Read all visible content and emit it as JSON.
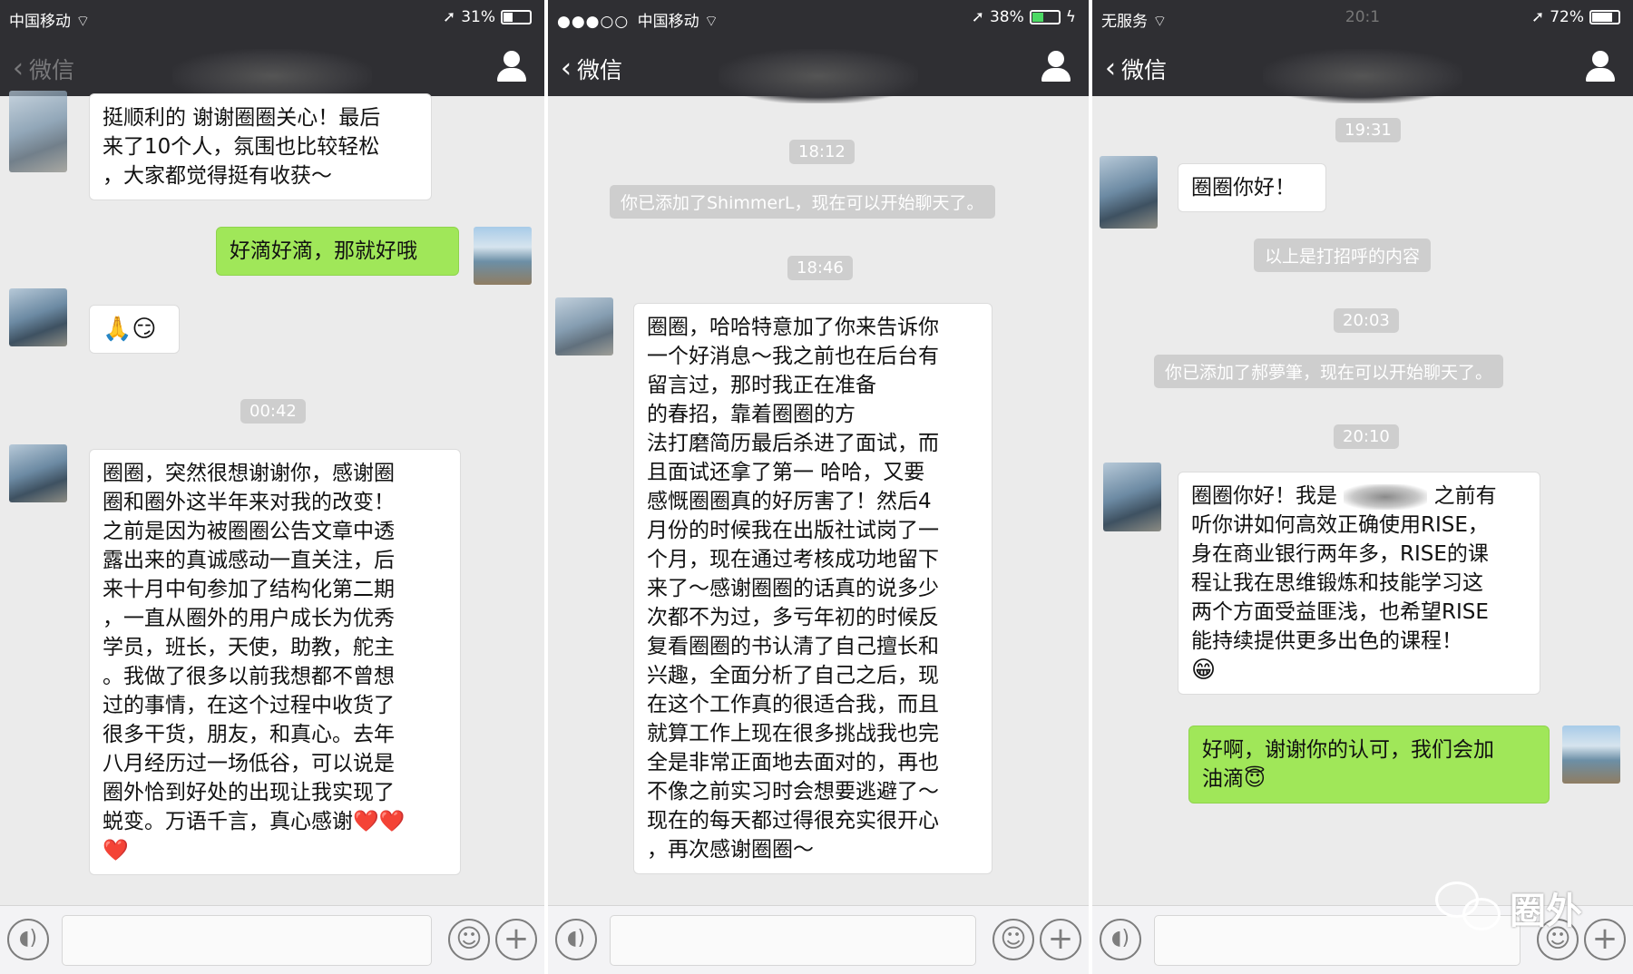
{
  "panels": [
    {
      "status": {
        "carrier": "中国移动",
        "signal": "",
        "time": "",
        "battery": "31%",
        "battery_level": 0.31
      },
      "nav": {
        "back": "微信"
      },
      "messages": [
        {
          "lines": [
            "挺顺利的 谢谢圈圈关心！最后",
            "来了10个人，氛围也比较轻松",
            "，大家都觉得挺有收获～"
          ]
        },
        {
          "lines": [
            "好滴好滴，那就好哦"
          ]
        },
        {
          "lines": [
            "🙏😏"
          ]
        },
        {
          "lines": [
            "圈圈，突然很想谢谢你，感谢圈",
            "圈和圈外这半年来对我的改变！",
            "之前是因为被圈圈公告文章中透",
            "露出来的真诚感动一直关注，后",
            "来十月中旬参加了结构化第二期",
            "，一直从圈外的用户成长为优秀",
            "学员，班长，天使，助教，舵主",
            "。我做了很多以前我想都不曾想",
            "过的事情，在这个过程中收货了",
            "很多干货，朋友，和真心。去年",
            "八月经历过一场低谷，可以说是",
            "圈外恰到好处的出现让我实现了",
            "蜕变。万语千言，真心感谢❤️❤️",
            "❤️"
          ]
        }
      ],
      "times": [
        "00:42"
      ]
    },
    {
      "status": {
        "carrier": "中国移动",
        "signal": "●●●○○",
        "time": "",
        "battery": "38%",
        "battery_level": 0.38
      },
      "nav": {
        "back": "微信"
      },
      "times": [
        "18:12",
        "18:46"
      ],
      "system": [
        "你已添加了ShimmerL，现在可以开始聊天了。"
      ],
      "messages": [
        {
          "lines": [
            "圈圈，哈哈特意加了你来告诉你",
            "一个好消息～我之前也在后台有",
            "留言过，那时我正在准备",
            "的春招，靠着圈圈的方",
            "法打磨简历最后杀进了面试，而",
            "且面试还拿了第一 哈哈，又要",
            "感慨圈圈真的好厉害了！然后4",
            "月份的时候我在出版社试岗了一",
            "个月，现在通过考核成功地留下",
            "来了～感谢圈圈的话真的说多少",
            "次都不为过，多亏年初的时候反",
            "复看圈圈的书认清了自己擅长和",
            "兴趣，全面分析了自己之后，现",
            "在这个工作真的很适合我，而且",
            "就算工作上现在很多挑战我也完",
            "全是非常正面地去面对的，再也",
            "不像之前实习时会想要逃避了～",
            "现在的每天都过得很充实很开心",
            "，再次感谢圈圈～"
          ]
        }
      ]
    },
    {
      "status": {
        "carrier": "无服务",
        "signal": "",
        "time": "20:1",
        "battery": "72%",
        "battery_level": 0.72
      },
      "nav": {
        "back": "微信"
      },
      "times": [
        "19:31",
        "20:03",
        "20:10"
      ],
      "system": [
        "以上是打招呼的内容",
        "你已添加了郝夢筆，现在可以开始聊天了。"
      ],
      "messages": [
        {
          "lines": [
            "圈圈你好！"
          ]
        },
        {
          "lines": [
            "圈圈你好！我是",
            "之前有",
            "听你讲如何高效正确使用RISE，",
            "身在商业银行两年多，RISE的课",
            "程让我在思维锻炼和技能学习这",
            "两个方面受益匪浅，也希望RISE",
            "能持续提供更多出色的课程！",
            "😁"
          ]
        },
        {
          "lines": [
            "好啊，谢谢你的认可，我们会加",
            "油滴😇"
          ]
        }
      ]
    }
  ],
  "watermark": {
    "text": "圈外",
    "icon": "wechat-logo-icon"
  },
  "colors": {
    "bar": "#2f2f33",
    "chat_bg": "#ebebeb",
    "bubble_out": "#a0e759",
    "bubble_in": "#ffffff",
    "chip": "#cecece"
  }
}
